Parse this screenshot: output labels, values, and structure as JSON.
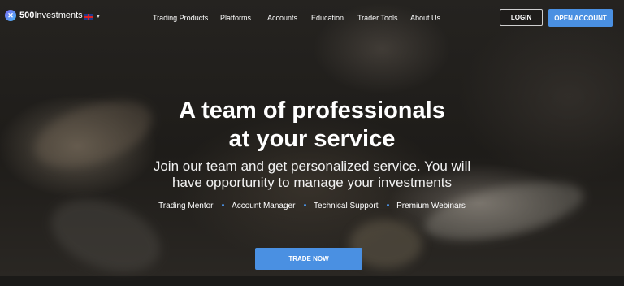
{
  "header": {
    "logo": {
      "mark": "✕",
      "bold": "500",
      "rest": "Investments"
    },
    "language": {
      "icon": "uk-flag-icon"
    },
    "nav": [
      "Trading Products",
      "Platforms",
      "Accounts",
      "Education",
      "Trader Tools",
      "About Us"
    ],
    "login_label": "LOGIN",
    "open_account_label": "OPEN ACCOUNT"
  },
  "hero": {
    "headline_line1": "A team of professionals",
    "headline_line2": "at your service",
    "subtitle_line1": "Join our team and get personalized service. You will",
    "subtitle_line2": "have opportunity to manage your investments",
    "features": [
      "Trading Mentor",
      "Account Manager",
      "Technical Support",
      "Premium Webinars"
    ],
    "cta_label": "TRADE NOW"
  },
  "colors": {
    "accent": "#4a90e2",
    "text": "#ffffff"
  }
}
